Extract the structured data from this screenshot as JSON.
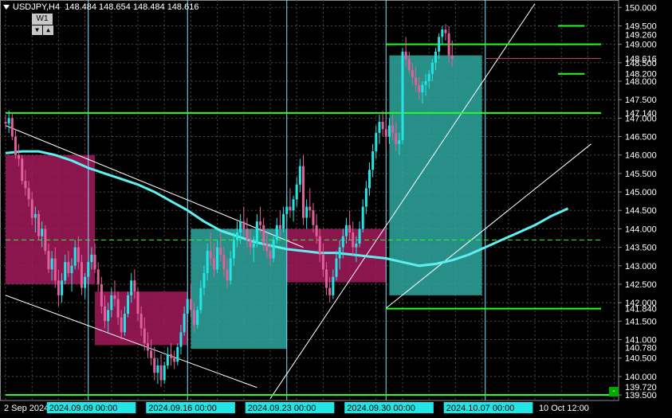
{
  "header": {
    "symbol": "USDJPY,H4",
    "ohlc": "148.484 148.654 148.484 148.616"
  },
  "timeframe_box": {
    "label": "W1",
    "down_icon": "▼",
    "up_icon": "▲"
  },
  "colors": {
    "background": "#000000",
    "bull": "#22e6e6",
    "bear": "#e0609a",
    "ma": "#5ef0f0",
    "level": "#22ff22",
    "zone_bull": "#2fa8a0",
    "zone_bear": "#a3195b",
    "grid": "#4a4a4a",
    "channel": "#ffffff",
    "session": "#7fe0ff"
  },
  "mini_button": "-",
  "chart_data": {
    "type": "candlestick",
    "ylim": [
      139.35,
      150.2
    ],
    "y_ticks": [
      "150.000",
      "149.500",
      "149.000",
      "148.500",
      "148.000",
      "147.500",
      "147.000",
      "146.500",
      "146.000",
      "145.500",
      "145.000",
      "144.500",
      "144.000",
      "143.500",
      "143.000",
      "142.500",
      "142.000",
      "141.500",
      "141.000",
      "140.500",
      "140.000",
      "139.500"
    ],
    "y_tick_values": [
      150.0,
      149.5,
      149.0,
      148.5,
      148.0,
      147.5,
      147.0,
      146.5,
      146.0,
      145.5,
      145.0,
      144.5,
      144.0,
      143.5,
      143.0,
      142.5,
      142.0,
      141.5,
      141.0,
      140.5,
      140.0,
      139.5
    ],
    "price_labels": [
      {
        "text": "149.260",
        "value": 149.26
      },
      {
        "text": "148.616",
        "value": 148.616
      },
      {
        "text": "148.200",
        "value": 148.2
      },
      {
        "text": "147.140",
        "value": 147.14
      },
      {
        "text": "141.840",
        "value": 141.84
      },
      {
        "text": "140.780",
        "value": 140.78
      },
      {
        "text": "139.720",
        "value": 139.72
      }
    ],
    "x_labels": [
      {
        "text": "2 Sep 2024",
        "bar": 0,
        "highlight": false
      },
      {
        "text": "2024.09.09 00:00",
        "bar": 25,
        "highlight": true
      },
      {
        "text": "2024.09.16 00:00",
        "bar": 55,
        "highlight": true
      },
      {
        "text": "2024.09.23 00:00",
        "bar": 85,
        "highlight": true
      },
      {
        "text": "2024.09.30 00:00",
        "bar": 115,
        "highlight": true
      },
      {
        "text": "2024.10.07 00:00",
        "bar": 145,
        "highlight": true
      },
      {
        "text": "10 Oct 12:00",
        "bar": 173,
        "highlight": false
      }
    ],
    "session_lines": [
      25,
      55,
      85,
      115,
      145
    ],
    "horizontal_levels": [
      {
        "value": 149.0,
        "from_bar": 115,
        "to_bar": 180,
        "style": "solid"
      },
      {
        "value": 147.14,
        "from_bar": 0,
        "to_bar": 180,
        "style": "solid"
      },
      {
        "value": 141.84,
        "from_bar": 115,
        "to_bar": 180,
        "style": "solid"
      },
      {
        "value": 139.5,
        "from_bar": 0,
        "to_bar": 200,
        "style": "solid"
      },
      {
        "value": 143.7,
        "from_bar": 0,
        "to_bar": 180,
        "style": "dashed"
      },
      {
        "value": 149.5,
        "from_bar": 167,
        "to_bar": 175,
        "style": "solid"
      },
      {
        "value": 148.2,
        "from_bar": 167,
        "to_bar": 175,
        "style": "solid"
      },
      {
        "value": 148.616,
        "from_bar": 145,
        "to_bar": 180,
        "style": "dashed-red"
      }
    ],
    "zones": [
      {
        "from_bar": 0,
        "to_bar": 27,
        "top": 146.0,
        "bottom": 142.5,
        "kind": "bear"
      },
      {
        "from_bar": 27,
        "to_bar": 55,
        "top": 142.3,
        "bottom": 140.85,
        "kind": "bear"
      },
      {
        "from_bar": 56,
        "to_bar": 85,
        "top": 144.0,
        "bottom": 140.75,
        "kind": "bull"
      },
      {
        "from_bar": 85,
        "to_bar": 115,
        "top": 144.0,
        "bottom": 142.55,
        "kind": "bear"
      },
      {
        "from_bar": 116,
        "to_bar": 144,
        "top": 148.7,
        "bottom": 142.2,
        "kind": "bull"
      }
    ],
    "channel_lines": [
      {
        "x1": 0,
        "y1": 146.8,
        "x2": 90,
        "y2": 143.5
      },
      {
        "x1": 0,
        "y1": 142.2,
        "x2": 76,
        "y2": 139.7
      },
      {
        "x1": 80,
        "y1": 139.4,
        "x2": 160,
        "y2": 150.1
      },
      {
        "x1": 115,
        "y1": 141.85,
        "x2": 177,
        "y2": 146.3
      }
    ],
    "ma_line": [
      [
        0,
        146.05
      ],
      [
        5,
        146.1
      ],
      [
        10,
        146.1
      ],
      [
        15,
        146.0
      ],
      [
        20,
        145.85
      ],
      [
        25,
        145.65
      ],
      [
        30,
        145.5
      ],
      [
        35,
        145.35
      ],
      [
        40,
        145.2
      ],
      [
        45,
        145.0
      ],
      [
        50,
        144.75
      ],
      [
        55,
        144.5
      ],
      [
        60,
        144.2
      ],
      [
        65,
        143.95
      ],
      [
        70,
        143.8
      ],
      [
        75,
        143.65
      ],
      [
        80,
        143.55
      ],
      [
        85,
        143.45
      ],
      [
        90,
        143.4
      ],
      [
        95,
        143.35
      ],
      [
        100,
        143.35
      ],
      [
        105,
        143.3
      ],
      [
        110,
        143.25
      ],
      [
        115,
        143.2
      ],
      [
        120,
        143.1
      ],
      [
        125,
        143.0
      ],
      [
        130,
        143.05
      ],
      [
        135,
        143.15
      ],
      [
        140,
        143.3
      ],
      [
        145,
        143.5
      ],
      [
        150,
        143.7
      ],
      [
        155,
        143.9
      ],
      [
        160,
        144.1
      ],
      [
        165,
        144.35
      ],
      [
        170,
        144.55
      ]
    ],
    "candles": [
      [
        146.9,
        147.1,
        146.7,
        146.85
      ],
      [
        146.85,
        147.2,
        146.6,
        147.0
      ],
      [
        147.0,
        147.14,
        146.4,
        146.5
      ],
      [
        146.5,
        146.7,
        145.9,
        146.0
      ],
      [
        146.0,
        146.3,
        145.7,
        145.9
      ],
      [
        145.9,
        146.0,
        145.2,
        145.3
      ],
      [
        145.3,
        145.6,
        144.9,
        145.1
      ],
      [
        145.1,
        145.3,
        144.6,
        144.8
      ],
      [
        144.8,
        145.0,
        144.1,
        144.3
      ],
      [
        144.3,
        144.6,
        143.9,
        144.4
      ],
      [
        144.4,
        144.5,
        143.7,
        143.8
      ],
      [
        143.8,
        144.2,
        143.5,
        144.0
      ],
      [
        144.0,
        144.1,
        143.3,
        143.4
      ],
      [
        143.4,
        143.6,
        142.8,
        142.9
      ],
      [
        142.9,
        143.4,
        142.6,
        143.2
      ],
      [
        143.2,
        143.5,
        142.4,
        142.6
      ],
      [
        142.6,
        142.9,
        141.9,
        142.2
      ],
      [
        142.2,
        142.8,
        142.0,
        142.6
      ],
      [
        142.6,
        143.3,
        142.5,
        143.1
      ],
      [
        143.1,
        143.4,
        142.7,
        142.8
      ],
      [
        142.8,
        143.2,
        142.3,
        143.0
      ],
      [
        143.0,
        143.7,
        142.9,
        143.5
      ],
      [
        143.5,
        143.8,
        142.9,
        143.1
      ],
      [
        143.1,
        143.3,
        142.2,
        142.4
      ],
      [
        142.4,
        142.8,
        142.1,
        142.7
      ],
      [
        142.7,
        143.2,
        142.6,
        143.1
      ],
      [
        143.1,
        143.5,
        142.9,
        143.3
      ],
      [
        143.3,
        143.6,
        142.8,
        142.9
      ],
      [
        142.9,
        143.1,
        142.3,
        142.5
      ],
      [
        142.5,
        142.7,
        141.7,
        141.9
      ],
      [
        141.9,
        142.2,
        141.3,
        141.5
      ],
      [
        141.5,
        142.0,
        141.2,
        141.8
      ],
      [
        141.8,
        142.4,
        141.6,
        142.2
      ],
      [
        142.2,
        142.6,
        141.9,
        142.1
      ],
      [
        142.1,
        142.3,
        141.4,
        141.6
      ],
      [
        141.6,
        141.8,
        141.0,
        141.2
      ],
      [
        141.2,
        141.9,
        141.1,
        141.7
      ],
      [
        141.7,
        142.3,
        141.6,
        142.2
      ],
      [
        142.2,
        142.8,
        142.0,
        142.6
      ],
      [
        142.6,
        142.9,
        142.1,
        142.3
      ],
      [
        142.3,
        142.4,
        141.5,
        141.7
      ],
      [
        141.7,
        141.9,
        141.1,
        141.3
      ],
      [
        141.3,
        141.6,
        140.7,
        140.9
      ],
      [
        140.9,
        141.2,
        140.5,
        140.7
      ],
      [
        140.7,
        141.0,
        140.3,
        140.5
      ],
      [
        140.5,
        140.8,
        139.9,
        140.1
      ],
      [
        140.1,
        140.5,
        139.8,
        140.3
      ],
      [
        140.3,
        140.6,
        139.72,
        139.9
      ],
      [
        139.9,
        140.4,
        139.8,
        140.3
      ],
      [
        140.3,
        140.8,
        140.2,
        140.6
      ],
      [
        140.6,
        140.9,
        140.3,
        140.5
      ],
      [
        140.5,
        140.7,
        140.2,
        140.4
      ],
      [
        140.4,
        140.9,
        140.3,
        140.8
      ],
      [
        140.8,
        141.4,
        140.6,
        141.2
      ],
      [
        141.2,
        141.9,
        141.1,
        141.7
      ],
      [
        141.7,
        142.3,
        141.5,
        142.1
      ],
      [
        142.1,
        142.5,
        141.6,
        141.8
      ],
      [
        141.8,
        142.0,
        141.2,
        141.4
      ],
      [
        141.4,
        141.9,
        141.3,
        141.8
      ],
      [
        141.8,
        142.6,
        141.7,
        142.4
      ],
      [
        142.4,
        143.0,
        142.2,
        142.8
      ],
      [
        142.8,
        143.6,
        142.6,
        143.4
      ],
      [
        143.4,
        143.9,
        143.0,
        143.2
      ],
      [
        143.2,
        143.6,
        142.7,
        142.9
      ],
      [
        142.9,
        143.7,
        142.8,
        143.5
      ],
      [
        143.5,
        143.9,
        143.1,
        143.3
      ],
      [
        143.3,
        143.5,
        142.7,
        142.9
      ],
      [
        142.9,
        143.2,
        142.4,
        142.6
      ],
      [
        142.6,
        143.4,
        142.5,
        143.2
      ],
      [
        143.2,
        143.9,
        143.0,
        143.7
      ],
      [
        143.7,
        144.2,
        143.5,
        143.9
      ],
      [
        143.9,
        144.4,
        143.6,
        144.2
      ],
      [
        144.2,
        144.6,
        143.8,
        144.0
      ],
      [
        144.0,
        144.3,
        143.5,
        143.7
      ],
      [
        143.7,
        144.0,
        143.3,
        143.5
      ],
      [
        143.5,
        143.8,
        143.1,
        143.6
      ],
      [
        143.6,
        144.4,
        143.5,
        144.2
      ],
      [
        144.2,
        144.6,
        143.9,
        144.1
      ],
      [
        144.1,
        144.3,
        143.4,
        143.6
      ],
      [
        143.6,
        143.9,
        143.2,
        143.4
      ],
      [
        143.4,
        143.6,
        143.0,
        143.2
      ],
      [
        143.2,
        143.8,
        143.1,
        143.7
      ],
      [
        143.7,
        144.3,
        143.6,
        144.1
      ],
      [
        144.1,
        144.5,
        143.8,
        144.0
      ],
      [
        144.0,
        144.6,
        143.9,
        144.4
      ],
      [
        144.4,
        144.9,
        144.2,
        144.6
      ],
      [
        144.6,
        145.1,
        144.3,
        144.5
      ],
      [
        144.5,
        144.9,
        144.2,
        144.8
      ],
      [
        144.8,
        145.4,
        144.6,
        145.2
      ],
      [
        145.2,
        145.9,
        145.0,
        145.7
      ],
      [
        145.7,
        146.0,
        144.1,
        144.3
      ],
      [
        144.3,
        144.8,
        144.0,
        144.6
      ],
      [
        144.6,
        145.1,
        144.3,
        144.5
      ],
      [
        144.5,
        144.7,
        143.9,
        144.1
      ],
      [
        144.1,
        144.4,
        143.6,
        143.8
      ],
      [
        143.8,
        144.0,
        143.1,
        143.3
      ],
      [
        143.3,
        143.6,
        142.7,
        142.9
      ],
      [
        142.9,
        143.1,
        142.2,
        142.4
      ],
      [
        142.4,
        142.7,
        142.0,
        142.2
      ],
      [
        142.2,
        142.9,
        142.1,
        142.7
      ],
      [
        142.7,
        143.4,
        142.6,
        143.2
      ],
      [
        143.2,
        143.7,
        142.9,
        143.5
      ],
      [
        143.5,
        144.0,
        143.2,
        143.8
      ],
      [
        143.8,
        144.3,
        143.6,
        144.1
      ],
      [
        144.1,
        144.5,
        143.7,
        143.9
      ],
      [
        143.9,
        144.2,
        143.3,
        143.5
      ],
      [
        143.5,
        143.8,
        143.1,
        143.6
      ],
      [
        143.6,
        144.2,
        143.5,
        144.0
      ],
      [
        144.0,
        144.8,
        143.9,
        144.6
      ],
      [
        144.6,
        145.3,
        144.4,
        145.1
      ],
      [
        145.1,
        145.8,
        144.9,
        145.6
      ],
      [
        145.6,
        146.3,
        145.4,
        146.1
      ],
      [
        146.1,
        146.8,
        145.9,
        146.6
      ],
      [
        146.6,
        147.1,
        146.3,
        146.9
      ],
      [
        146.9,
        147.2,
        146.5,
        146.7
      ],
      [
        146.7,
        147.0,
        146.2,
        146.5
      ],
      [
        146.5,
        147.0,
        146.3,
        146.8
      ],
      [
        146.8,
        147.1,
        146.4,
        146.6
      ],
      [
        146.6,
        146.9,
        146.1,
        146.3
      ],
      [
        146.3,
        146.6,
        146.0,
        146.4
      ],
      [
        146.4,
        148.9,
        146.3,
        148.8
      ],
      [
        148.8,
        149.2,
        148.4,
        148.6
      ],
      [
        148.6,
        148.8,
        148.2,
        148.3
      ],
      [
        148.3,
        148.5,
        147.9,
        148.1
      ],
      [
        148.1,
        148.4,
        147.7,
        147.9
      ],
      [
        147.9,
        148.1,
        147.5,
        147.7
      ],
      [
        147.7,
        148.0,
        147.4,
        147.9
      ],
      [
        147.9,
        148.2,
        147.6,
        148.0
      ],
      [
        148.0,
        148.3,
        147.8,
        148.2
      ],
      [
        148.2,
        148.6,
        148.0,
        148.5
      ],
      [
        148.5,
        148.9,
        148.3,
        148.8
      ],
      [
        148.8,
        149.3,
        148.6,
        149.2
      ],
      [
        149.2,
        149.5,
        149.0,
        149.4
      ],
      [
        149.4,
        149.55,
        149.1,
        149.3
      ],
      [
        149.3,
        149.5,
        148.5,
        148.7
      ],
      [
        148.7,
        149.1,
        148.4,
        148.616
      ]
    ]
  }
}
